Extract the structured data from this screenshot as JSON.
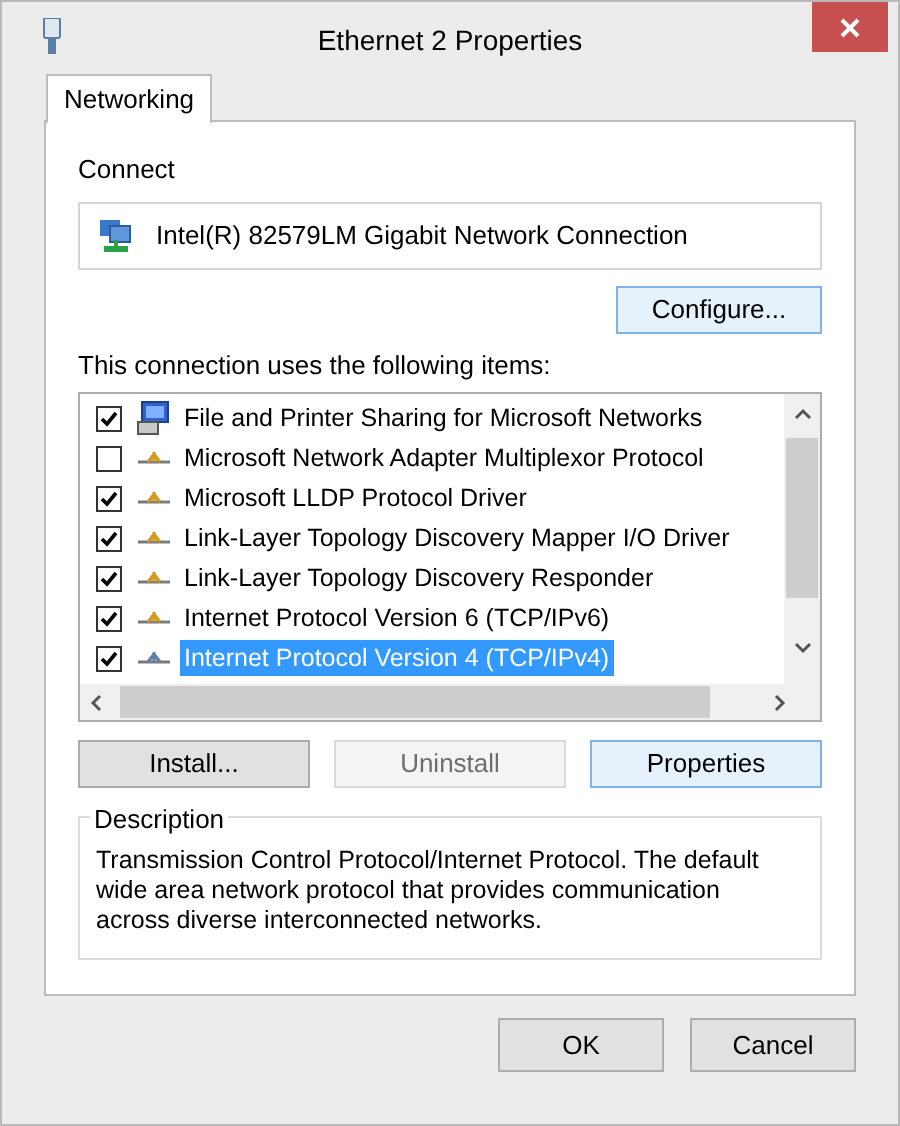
{
  "window": {
    "title": "Ethernet 2 Properties"
  },
  "tabs": [
    {
      "label": "Networking",
      "selected": true
    }
  ],
  "connect": {
    "label": "Connect",
    "adapter": "Intel(R) 82579LM Gigabit Network Connection",
    "configure_button": "Configure..."
  },
  "items_label": "This connection uses the following items:",
  "items": [
    {
      "kind": "service",
      "label": "File and Printer Sharing for Microsoft Networks",
      "checked": true,
      "selected": false
    },
    {
      "kind": "protocol",
      "label": "Microsoft Network Adapter Multiplexor Protocol",
      "checked": false,
      "selected": false
    },
    {
      "kind": "protocol",
      "label": "Microsoft LLDP Protocol Driver",
      "checked": true,
      "selected": false
    },
    {
      "kind": "protocol",
      "label": "Link-Layer Topology Discovery Mapper I/O Driver",
      "checked": true,
      "selected": false
    },
    {
      "kind": "protocol",
      "label": "Link-Layer Topology Discovery Responder",
      "checked": true,
      "selected": false
    },
    {
      "kind": "protocol",
      "label": "Internet Protocol Version 6 (TCP/IPv6)",
      "checked": true,
      "selected": false
    },
    {
      "kind": "protocol",
      "label": "Internet Protocol Version 4 (TCP/IPv4)",
      "checked": true,
      "selected": true
    }
  ],
  "item_buttons": [
    {
      "label": "Install...",
      "disabled": false,
      "focused": false
    },
    {
      "label": "Uninstall",
      "disabled": true,
      "focused": false
    },
    {
      "label": "Properties",
      "disabled": false,
      "focused": true
    }
  ],
  "description": {
    "title": "Description",
    "text": "Transmission Control Protocol/Internet Protocol. The default wide area network protocol that provides communication across diverse interconnected networks."
  },
  "dialog_buttons": [
    "OK",
    "Cancel"
  ]
}
